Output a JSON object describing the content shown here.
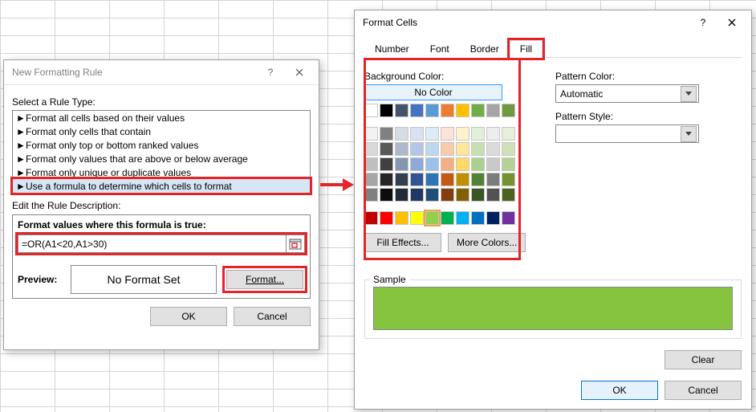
{
  "nfr": {
    "title": "New Formatting Rule",
    "select_rule_type_label": "Select a Rule Type:",
    "rules": [
      "Format all cells based on their values",
      "Format only cells that contain",
      "Format only top or bottom ranked values",
      "Format only values that are above or below average",
      "Format only unique or duplicate values",
      "Use a formula to determine which cells to format"
    ],
    "edit_desc_label": "Edit the Rule Description:",
    "formula_label": "Format values where this formula is true:",
    "formula_value": "=OR(A1<20,A1>30)",
    "preview_label": "Preview:",
    "preview_text": "No Format Set",
    "format_btn": "Format...",
    "ok": "OK",
    "cancel": "Cancel"
  },
  "fc": {
    "title": "Format Cells",
    "tabs": {
      "number": "Number",
      "font": "Font",
      "border": "Border",
      "fill": "Fill"
    },
    "bg_label": "Background Color:",
    "no_color": "No Color",
    "fill_effects": "Fill Effects...",
    "more_colors": "More Colors...",
    "pattern_color_label": "Pattern Color:",
    "pattern_color_value": "Automatic",
    "pattern_style_label": "Pattern Style:",
    "pattern_style_value": "",
    "sample_label": "Sample",
    "clear": "Clear",
    "ok": "OK",
    "cancel": "Cancel",
    "sample_color": "#86c440",
    "palette_theme_row1": [
      "#ffffff",
      "#000000",
      "#44546a",
      "#4472c4",
      "#5b9bd5",
      "#ed7d31",
      "#ffc000",
      "#70ad47",
      "#a5a5a5",
      "#6f9b3e"
    ],
    "palette_theme_shades": [
      [
        "#f2f2f2",
        "#808080",
        "#d6dce4",
        "#d9e1f2",
        "#ddebf7",
        "#fce4d6",
        "#fff2cc",
        "#e2efda",
        "#ededed",
        "#e7f0db"
      ],
      [
        "#d9d9d9",
        "#595959",
        "#acb9ca",
        "#b4c6e7",
        "#bdd7ee",
        "#f8cbad",
        "#ffe699",
        "#c6e0b4",
        "#dbdbdb",
        "#d0e0b8"
      ],
      [
        "#bfbfbf",
        "#404040",
        "#8497b0",
        "#8ea9db",
        "#9bc2e6",
        "#f4b084",
        "#ffd966",
        "#a9d08e",
        "#c9c9c9",
        "#b5d296"
      ],
      [
        "#a6a6a6",
        "#262626",
        "#333f4f",
        "#305496",
        "#2f75b5",
        "#c65911",
        "#bf8f00",
        "#548235",
        "#7b7b7b",
        "#72932e"
      ],
      [
        "#808080",
        "#0d0d0d",
        "#222b35",
        "#203764",
        "#1f4e78",
        "#833c0c",
        "#806000",
        "#375623",
        "#525252",
        "#4a6420"
      ]
    ],
    "palette_standard": [
      "#c00000",
      "#ff0000",
      "#ffc000",
      "#ffff00",
      "#92d050",
      "#00b050",
      "#00b0f0",
      "#0070c0",
      "#002060",
      "#7030a0"
    ],
    "selected_swatch": "#92d050"
  }
}
